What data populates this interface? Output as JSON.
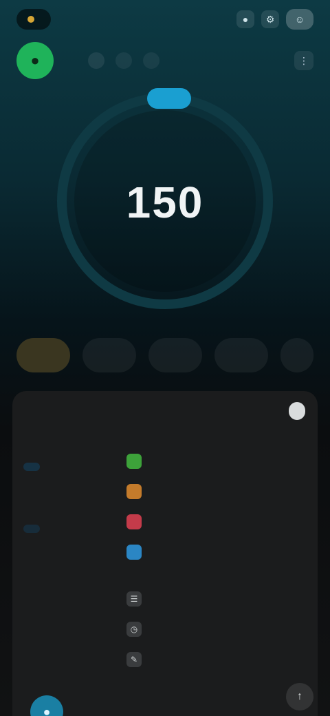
{
  "topbar": {
    "user_label": "",
    "icons": [
      "bell-icon",
      "gear-icon",
      "profile-icon"
    ]
  },
  "sensor": {
    "icon": "drop-icon",
    "chips": [
      "",
      "",
      ""
    ]
  },
  "reading": {
    "trend": "",
    "label": "",
    "value": "150",
    "unit": ""
  },
  "ranges": [
    {
      "label": "",
      "active": true
    },
    {
      "label": "",
      "active": false
    },
    {
      "label": "",
      "active": false
    },
    {
      "label": "",
      "active": false
    },
    {
      "label": "",
      "active": false
    }
  ],
  "card": {
    "title": "",
    "toggle": "",
    "stats": [
      {
        "label": "",
        "value": "",
        "badge": ""
      },
      {
        "label": "",
        "value": "",
        "badge": ""
      },
      {
        "label": "",
        "value": ""
      },
      {
        "label": "",
        "value": ""
      }
    ],
    "legend": [
      {
        "color": "#3da23a",
        "text": ""
      },
      {
        "color": "#c47b2b",
        "text": ""
      },
      {
        "color": "#c43b4a",
        "text": ""
      },
      {
        "color": "#2b86c4",
        "text": ""
      }
    ],
    "legend_icons": [
      {
        "icon": "list-icon",
        "text": ""
      },
      {
        "icon": "clock-icon",
        "text": ""
      },
      {
        "icon": "pen-icon",
        "text": ""
      }
    ]
  },
  "colors": {
    "accent": "#1a9fd1",
    "sensor": "#1fb35a",
    "ring": "#0f3a44"
  }
}
